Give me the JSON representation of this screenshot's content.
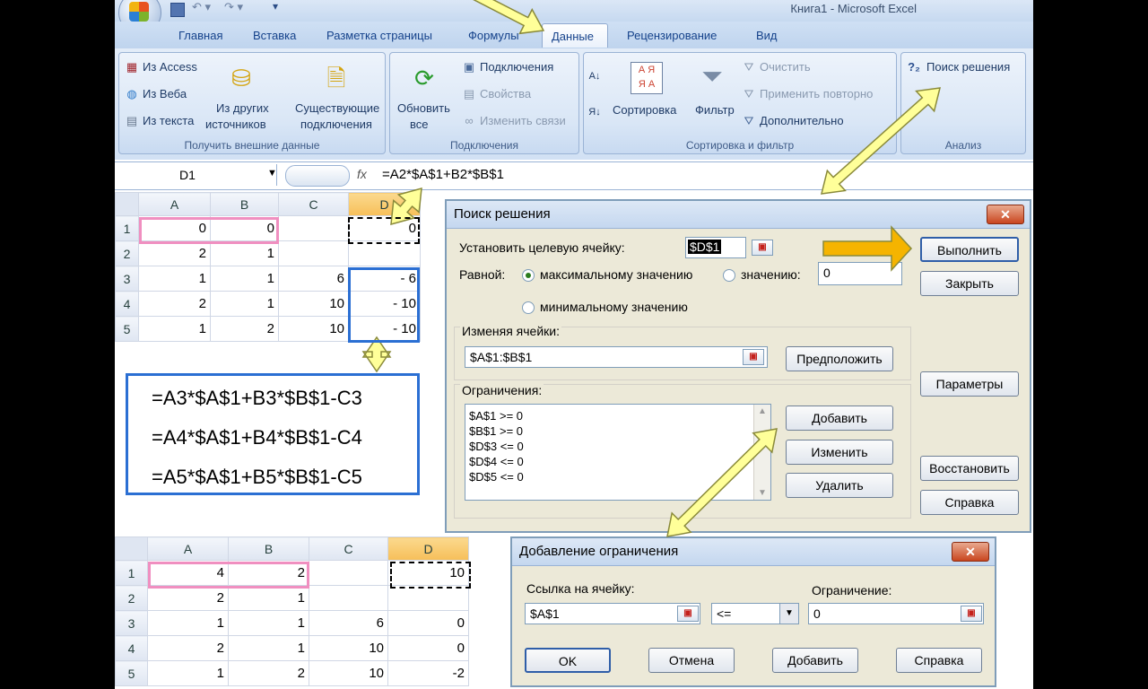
{
  "window": {
    "title": "Книга1 - Microsoft Excel"
  },
  "ribbon": {
    "tabs": [
      "Главная",
      "Вставка",
      "Разметка страницы",
      "Формулы",
      "Данные",
      "Рецензирование",
      "Вид"
    ],
    "active_tab": "Данные",
    "groups": {
      "external": {
        "label": "Получить внешние данные",
        "access": "Из Access",
        "web": "Из Веба",
        "text": "Из текста",
        "other1": "Из других",
        "other2": "источников",
        "existing1": "Существующие",
        "existing2": "подключения"
      },
      "connections": {
        "label": "Подключения",
        "refresh1": "Обновить",
        "refresh2": "все",
        "conn": "Подключения",
        "props": "Свойства",
        "links": "Изменить связи"
      },
      "sort": {
        "label": "Сортировка и фильтр",
        "sort": "Сортировка",
        "filter": "Фильтр",
        "clear": "Очистить",
        "reapply": "Применить повторно",
        "advanced": "Дополнительно"
      },
      "analysis": {
        "label": "Анализ",
        "solver": "Поиск решения"
      }
    }
  },
  "formula_bar": {
    "name_box": "D1",
    "fx": "fx",
    "formula": "=A2*$A$1+B2*$B$1"
  },
  "grid_top": {
    "columns": [
      "A",
      "B",
      "C",
      "D"
    ],
    "rows": [
      {
        "n": "1",
        "a": "0",
        "b": "0",
        "c": "",
        "d": "0"
      },
      {
        "n": "2",
        "a": "2",
        "b": "1",
        "c": "",
        "d": ""
      },
      {
        "n": "3",
        "a": "1",
        "b": "1",
        "c": "6",
        "d": "- 6"
      },
      {
        "n": "4",
        "a": "2",
        "b": "1",
        "c": "10",
        "d": "- 10"
      },
      {
        "n": "5",
        "a": "1",
        "b": "2",
        "c": "10",
        "d": "- 10"
      }
    ]
  },
  "formulas_box": {
    "lines": [
      "=A3*$A$1+B3*$B$1-C3",
      "=A4*$A$1+B4*$B$1-C4",
      "=A5*$A$1+B5*$B$1-C5"
    ]
  },
  "grid_bottom": {
    "columns": [
      "A",
      "B",
      "C",
      "D"
    ],
    "rows": [
      {
        "n": "1",
        "a": "4",
        "b": "2",
        "c": "",
        "d": "10"
      },
      {
        "n": "2",
        "a": "2",
        "b": "1",
        "c": "",
        "d": ""
      },
      {
        "n": "3",
        "a": "1",
        "b": "1",
        "c": "6",
        "d": "0"
      },
      {
        "n": "4",
        "a": "2",
        "b": "1",
        "c": "10",
        "d": "0"
      },
      {
        "n": "5",
        "a": "1",
        "b": "2",
        "c": "10",
        "d": "-2"
      }
    ]
  },
  "solver_dialog": {
    "title": "Поиск решения",
    "target_label": "Установить целевую ячейку:",
    "target_value": "$D$1",
    "equal_label": "Равной:",
    "opt_max": "максимальному значению",
    "opt_value": "значению:",
    "value_field": "0",
    "opt_min": "минимальному значению",
    "changing_label": "Изменяя ячейки:",
    "changing_value": "$A$1:$B$1",
    "guess_button": "Предположить",
    "constraints_label": "Ограничения:",
    "constraints": [
      "$A$1 >= 0",
      "$B$1 >= 0",
      "$D$3 <= 0",
      "$D$4 <= 0",
      "$D$5 <= 0"
    ],
    "add_button": "Добавить",
    "change_button": "Изменить",
    "delete_button": "Удалить",
    "run_button": "Выполнить",
    "close_button": "Закрыть",
    "params_button": "Параметры",
    "restore_button": "Восстановить",
    "help_button": "Справка"
  },
  "add_constraint_dialog": {
    "title": "Добавление ограничения",
    "ref_label": "Ссылка на ячейку:",
    "ref_value": "$A$1",
    "operator": "<=",
    "constraint_label": "Ограничение:",
    "constraint_value": "0",
    "ok_button": "OK",
    "cancel_button": "Отмена",
    "add_button": "Добавить",
    "help_button": "Справка"
  },
  "colors": {
    "arrow_fill": "#ffff99",
    "arrow_stroke": "#8a8a3a",
    "run_arrow": "#f5b400",
    "frame_blue": "#2b6fd3",
    "frame_pink": "#f08fc0"
  }
}
